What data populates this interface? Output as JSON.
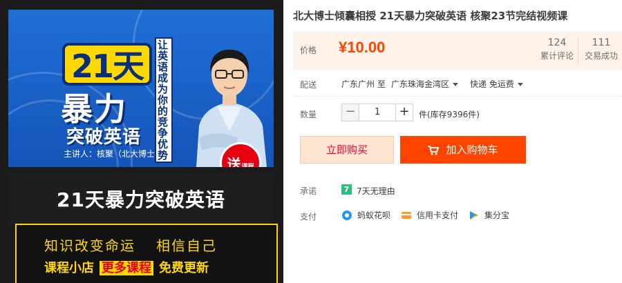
{
  "product": {
    "title": "北大博士倾囊相授 21天暴力突破英语 核聚23节完结视频课"
  },
  "image": {
    "badge": "21天",
    "headline1": "暴力",
    "headline2": "突破英语",
    "lecturer": "主讲人：核聚（北大博士）",
    "slogan": "让英语成为你的竞争优势",
    "send_main": "送",
    "send_sub": "课程",
    "subtitle": "21天暴力突破英语",
    "box_line1_a": "知识改变命运",
    "box_line1_b": "相信自己",
    "box_line2_a": "课程小店",
    "box_line2_b": "更多课程",
    "box_line2_c": "免费更新"
  },
  "price": {
    "label": "价格",
    "value": "¥10.00",
    "reviews_count": "124",
    "reviews_label": "累计评论",
    "deals_count": "111",
    "deals_label": "交易成功"
  },
  "delivery": {
    "label": "配送",
    "from": "广东广州 至",
    "to": "广东珠海金湾区",
    "method": "快递 免运费"
  },
  "quantity": {
    "label": "数量",
    "minus": "−",
    "value": "1",
    "plus": "+",
    "stock_text": "件(库存9396件)"
  },
  "actions": {
    "buy_now": "立即购买",
    "add_to_cart": "加入购物车"
  },
  "promise": {
    "label": "承诺",
    "icon_text": "7",
    "text": "7天无理由"
  },
  "payment": {
    "label": "支付",
    "methods": [
      {
        "icon": "huabei-icon",
        "label": "蚂蚁花呗",
        "color": "#1e9cf0"
      },
      {
        "icon": "credit-card-icon",
        "label": "信用卡支付",
        "color": "#ff9a2e"
      },
      {
        "icon": "jifenbao-icon",
        "label": "集分宝",
        "color": "#4caf50"
      }
    ]
  },
  "colors": {
    "accent": "#ff4400",
    "price_bg": "#fff2e8",
    "buy_now_bg": "#ffe4d0"
  }
}
